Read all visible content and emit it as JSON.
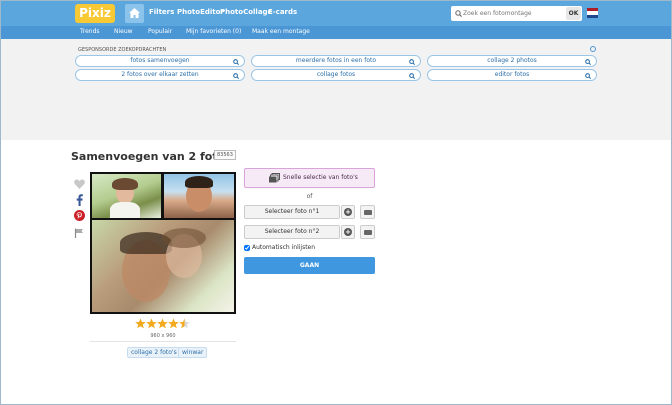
{
  "header": {
    "logo": "Pixiz",
    "nav": [
      "Filters",
      "PhotoEditor",
      "PhotoCollage",
      "E-cards"
    ],
    "search_placeholder": "Zoek een fotomontage",
    "search_button": "OK",
    "language_flag": "dutch-flag-icon"
  },
  "subnav": [
    "Trends",
    "Nieuw",
    "Populair",
    "Mijn favorieten (0)",
    "Maak een montage"
  ],
  "sponsored": {
    "title": "GESPONSORDE ZOEKOPDRACHTEN",
    "links": [
      "fotos samenvoegen",
      "meerdere fotos in een foto",
      "collage 2 photos",
      "2 fotos over elkaar zetten",
      "collage fotos",
      "editor fotos"
    ]
  },
  "template": {
    "title": "Samenvoegen van 2 foto's",
    "count": "83563",
    "dimensions": "960 x 960",
    "rating": 4.5,
    "tags": [
      "collage 2 foto's",
      "winwar"
    ]
  },
  "side_icons": [
    "heart-icon",
    "facebook-icon",
    "pinterest-icon",
    "flag-icon"
  ],
  "panel": {
    "quick_select": "Snelle selectie van foto's",
    "or": "of",
    "select_1": "Selecteer foto n°1",
    "select_2": "Selecteer foto n°2",
    "auto_crop": "Automatisch inlijsten",
    "go": "GAAN"
  },
  "colors": {
    "brand": "#5aa6dd",
    "subnav": "#4b96d4",
    "button": "#3f97df",
    "logo": "#f7c935"
  }
}
